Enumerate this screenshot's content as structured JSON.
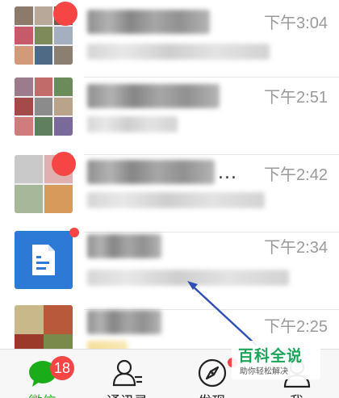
{
  "chats": [
    {
      "time": "下午3:04",
      "has_badge": true
    },
    {
      "time": "下午2:51",
      "has_badge": false
    },
    {
      "time": "下午2:42",
      "has_badge": true,
      "title_ellipsis": "..."
    },
    {
      "time": "下午2:34",
      "has_badge": true
    },
    {
      "time": "下午2:25",
      "has_badge": false
    }
  ],
  "tabs": {
    "chats": {
      "label": "微信",
      "badge": "18",
      "icon": "chat-bubble-icon"
    },
    "contacts": {
      "label": "通讯录",
      "icon": "contacts-icon"
    },
    "discover": {
      "label": "发现",
      "icon": "compass-icon"
    },
    "me": {
      "label": "我",
      "icon": "person-icon"
    }
  },
  "watermark": {
    "title": "百科全说",
    "subtitle": "助你轻松解决"
  },
  "colors": {
    "accent": "#1aad19",
    "badge": "#f54545",
    "app_icon_blue": "#2d7ad6",
    "watermark_green": "#1aa55a"
  }
}
